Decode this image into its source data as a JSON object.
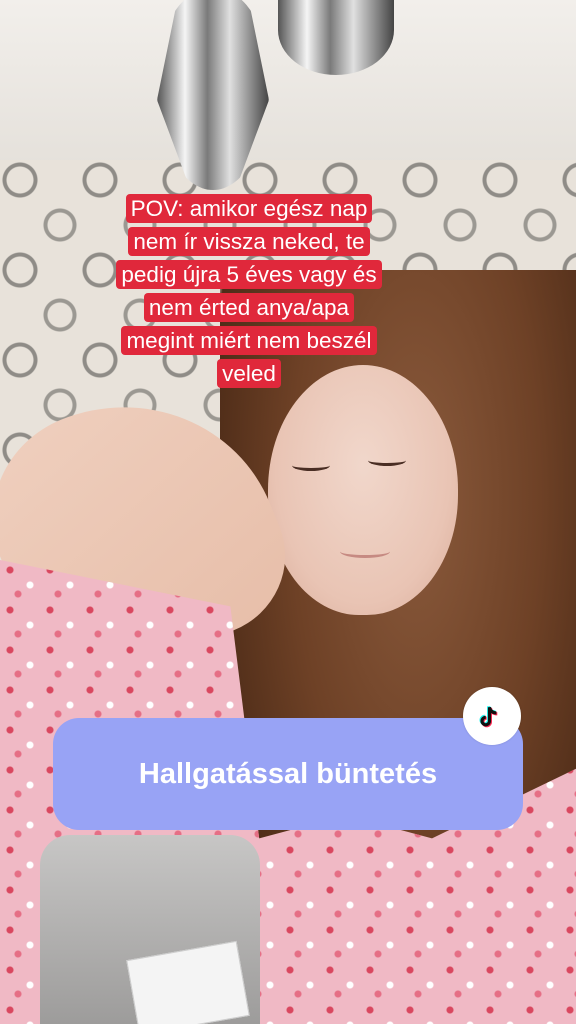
{
  "overlay": {
    "caption_lines": [
      "POV: amikor egész nap",
      "nem ír vissza neked, te",
      "pedig újra 5 éves vagy és",
      "nem érted anya/apa",
      "megint miért nem beszél",
      "veled"
    ],
    "banner_text": "Hallgatással büntetés"
  },
  "icons": {
    "watermark": "tiktok-logo-icon"
  },
  "colors": {
    "caption_bg": "#e0283b",
    "banner_bg": "#98a3f5",
    "text": "#ffffff"
  }
}
